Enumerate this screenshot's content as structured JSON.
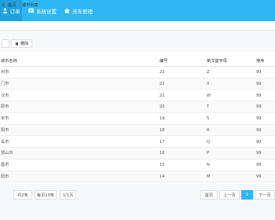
{
  "nav": {
    "items": [
      {
        "label": "订单",
        "icon": "user-icon"
      },
      {
        "label": "系统设置",
        "icon": "settings-panel-icon"
      },
      {
        "label": "洗车管理",
        "icon": "puzzle-icon"
      }
    ]
  },
  "breadcrumb": {
    "home": "首页",
    "separator": ">",
    "current": "城市列表"
  },
  "toolbar": {
    "delete_label": "删除"
  },
  "table": {
    "headers": [
      "城市名称",
      "编号",
      "英文首字母",
      "排序"
    ],
    "rows": [
      {
        "name": "州市",
        "code": "22",
        "letter": "Z",
        "sort": "99"
      },
      {
        "name": "门市",
        "code": "22",
        "letter": "X",
        "sort": "99"
      },
      {
        "name": "汉市",
        "code": "21",
        "letter": "W",
        "sort": "99"
      },
      {
        "name": "原市",
        "code": "20",
        "letter": "T",
        "sort": "99"
      },
      {
        "name": "京市",
        "code": "19",
        "letter": "S",
        "sort": "99"
      },
      {
        "name": "阳市",
        "code": "18",
        "letter": "R",
        "sort": "99"
      },
      {
        "name": "岛市",
        "code": "17",
        "letter": "Q",
        "sort": "99"
      },
      {
        "name": "顶山市",
        "code": "16",
        "letter": "P",
        "sort": "99"
      },
      {
        "name": "昌市",
        "code": "15",
        "letter": "N",
        "sort": "99"
      },
      {
        "name": "阳市",
        "code": "14",
        "letter": "M",
        "sort": "99"
      }
    ]
  },
  "pagination": {
    "total": "共2条",
    "per_page": "每页10条",
    "page_of": "1/1页",
    "first": "首页",
    "prev": "上一页",
    "current": "1",
    "next": "下一页"
  },
  "colors": {
    "accent": "#2db7f5"
  }
}
